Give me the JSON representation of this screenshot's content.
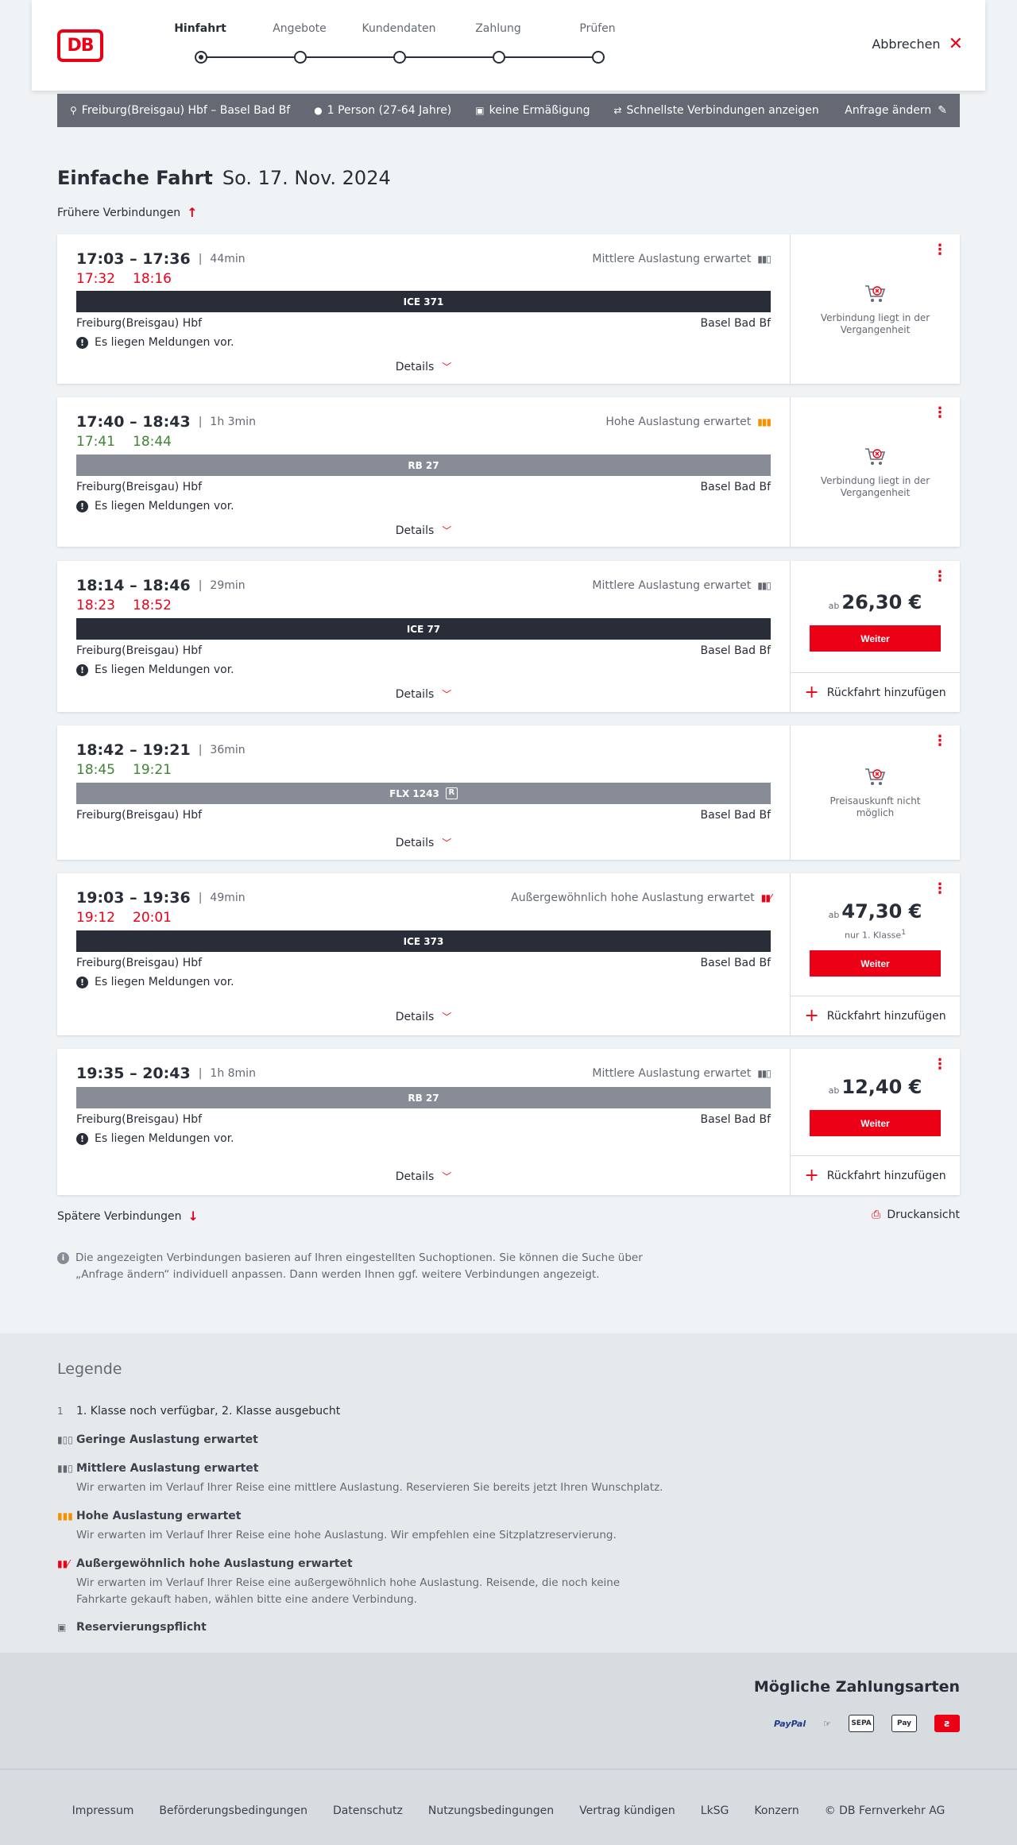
{
  "header": {
    "logo_text": "DB",
    "steps": [
      "Hinfahrt",
      "Angebote",
      "Kundendaten",
      "Zahlung",
      "Prüfen"
    ],
    "cancel_label": "Abbrechen"
  },
  "query": {
    "route": "Freiburg(Breisgau) Hbf – Basel Bad Bf",
    "travelers": "1 Person (27-64 Jahre)",
    "discount": "keine Ermäßigung",
    "fastest": "Schnellste Verbindungen anzeigen",
    "edit_label": "Anfrage ändern"
  },
  "title": {
    "trip_type": "Einfache Fahrt",
    "date": "So. 17. Nov. 2024"
  },
  "earlier_label": "Frühere Verbindungen",
  "later_label": "Spätere Verbindungen",
  "print_label": "Druckansicht",
  "details_label": "Details",
  "return_label": "Rückfahrt hinzufügen",
  "weiter_label": "Weiter",
  "ab_label": "ab",
  "message_text": "Es liegen Meldungen vor.",
  "connections": [
    {
      "times": "17:03 – 17:36",
      "duration": "44min",
      "rt_dep": "17:32",
      "rt_arr": "18:16",
      "load_text": "Mittlere Auslastung erwartet",
      "train": "ICE 371",
      "from": "Freiburg(Breisgau) Hbf",
      "to": "Basel Bad Bf",
      "unavailable_text": "Verbindung liegt in der Vergangenheit"
    },
    {
      "times": "17:40 – 18:43",
      "duration": "1h 3min",
      "rt_dep": "17:41",
      "rt_arr": "18:44",
      "load_text": "Hohe Auslastung erwartet",
      "train": "RB 27",
      "from": "Freiburg(Breisgau) Hbf",
      "to": "Basel Bad Bf",
      "unavailable_text": "Verbindung liegt in der Vergangenheit"
    },
    {
      "times": "18:14 – 18:46",
      "duration": "29min",
      "rt_dep": "18:23",
      "rt_arr": "18:52",
      "load_text": "Mittlere Auslastung erwartet",
      "train": "ICE 77",
      "from": "Freiburg(Breisgau) Hbf",
      "to": "Basel Bad Bf",
      "price": "26,30 €"
    },
    {
      "times": "18:42 – 19:21",
      "duration": "36min",
      "rt_dep": "18:45",
      "rt_arr": "19:21",
      "train": "FLX 1243",
      "reservation_symbol": "R",
      "from": "Freiburg(Breisgau) Hbf",
      "to": "Basel Bad Bf",
      "unavailable_text": "Preisauskunft nicht möglich"
    },
    {
      "times": "19:03 – 19:36",
      "duration": "49min",
      "rt_dep": "19:12",
      "rt_arr": "20:01",
      "load_text": "Außergewöhnlich hohe Auslastung erwartet",
      "train": "ICE 373",
      "from": "Freiburg(Breisgau) Hbf",
      "to": "Basel Bad Bf",
      "price": "47,30 €",
      "price_note": "nur 1. Klasse",
      "price_note_sup": "1"
    },
    {
      "times": "19:35 – 20:43",
      "duration": "1h 8min",
      "load_text": "Mittlere Auslastung erwartet",
      "train": "RB 27",
      "from": "Freiburg(Breisgau) Hbf",
      "to": "Basel Bad Bf",
      "price": "12,40 €"
    }
  ],
  "info_text": "Die angezeigten Verbindungen basieren auf Ihren eingestellten Suchoptionen. Sie können die Suche über „Anfrage ändern“ individuell anpassen. Dann werden Ihnen ggf. weitere Verbindungen angezeigt.",
  "legend": {
    "title": "Legende",
    "class_number": "1",
    "class_text": "1. Klasse noch verfügbar, 2. Klasse ausgebucht",
    "low_title": "Geringe Auslastung erwartet",
    "medium_title": "Mittlere Auslastung erwartet",
    "medium_desc": "Wir erwarten im Verlauf Ihrer Reise eine mittlere Auslastung. Reservieren Sie bereits jetzt Ihren Wunschplatz.",
    "high_title": "Hohe Auslastung erwartet",
    "high_desc": "Wir erwarten im Verlauf Ihrer Reise eine hohe Auslastung. Wir empfehlen eine Sitzplatzreservierung.",
    "extreme_title": "Außergewöhnlich hohe Auslastung erwartet",
    "extreme_desc": "Wir erwarten im Verlauf Ihrer Reise eine außergewöhnlich hohe Auslastung. Reisende, die noch keine Fahrkarte gekauft haben, wählen bitte eine andere Verbindung.",
    "reservation_title": "Reservierungspflicht"
  },
  "payment": {
    "title": "Mögliche Zahlungsarten",
    "methods": [
      "PayPal",
      "SEPA",
      "Pay"
    ]
  },
  "footer": {
    "links": [
      "Impressum",
      "Beförderungsbedingungen",
      "Datenschutz",
      "Nutzungsbedingungen",
      "Vertrag kündigen",
      "LkSG",
      "Konzern",
      "© DB Fernverkehr AG"
    ]
  },
  "colors": {
    "accent": "#ec0016",
    "dark": "#282d37",
    "grey": "#646973",
    "ontime": "#408335",
    "high_load": "#f39200"
  }
}
